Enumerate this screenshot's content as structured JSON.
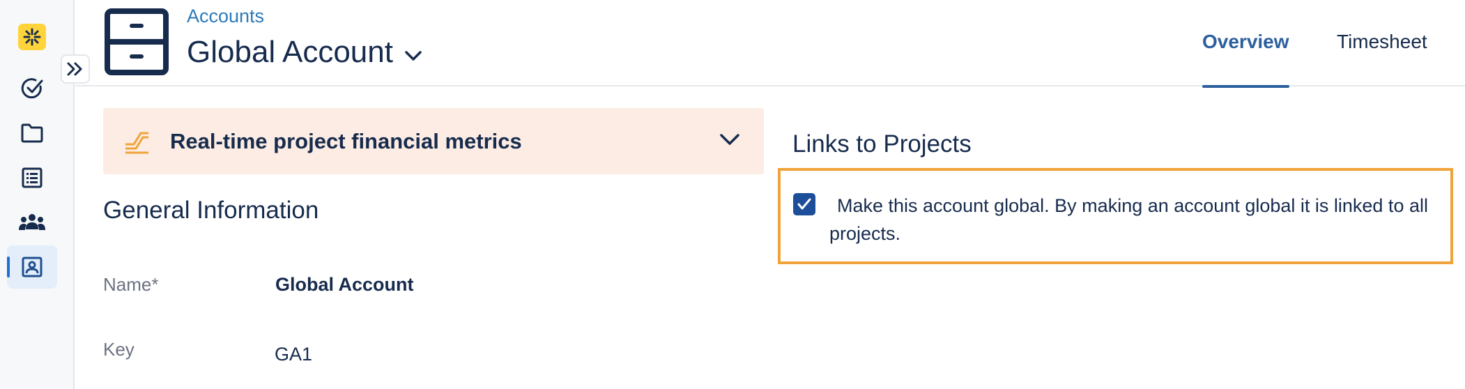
{
  "sidebar": {
    "items": [
      {
        "name": "app-logo",
        "icon": "sparkle-icon"
      },
      {
        "name": "tasks",
        "icon": "check-circle-icon"
      },
      {
        "name": "projects",
        "icon": "folder-icon"
      },
      {
        "name": "reports",
        "icon": "list-icon"
      },
      {
        "name": "teams",
        "icon": "people-icon"
      },
      {
        "name": "accounts",
        "icon": "contact-card-icon",
        "active": true
      }
    ],
    "expand_icon": "double-chevron-right-icon"
  },
  "header": {
    "breadcrumb": "Accounts",
    "title": "Global Account",
    "tabs": [
      {
        "label": "Overview",
        "active": true
      },
      {
        "label": "Timesheet",
        "active": false
      }
    ]
  },
  "metrics": {
    "title": "Real-time project financial metrics",
    "icon": "chart-trend-icon"
  },
  "general": {
    "title": "General Information",
    "fields": [
      {
        "label": "Name*",
        "value": "Global Account"
      },
      {
        "label": "Key",
        "value": "GA1"
      }
    ]
  },
  "links": {
    "title": "Links to Projects",
    "global_checked": true,
    "global_text": "Make this account global. By making an account global it is linked to all projects."
  },
  "colors": {
    "accent": "#2c5f9e",
    "highlight_border": "#f0a33a",
    "metrics_bg": "#fcece3",
    "logo_bg": "#ffd43b"
  }
}
